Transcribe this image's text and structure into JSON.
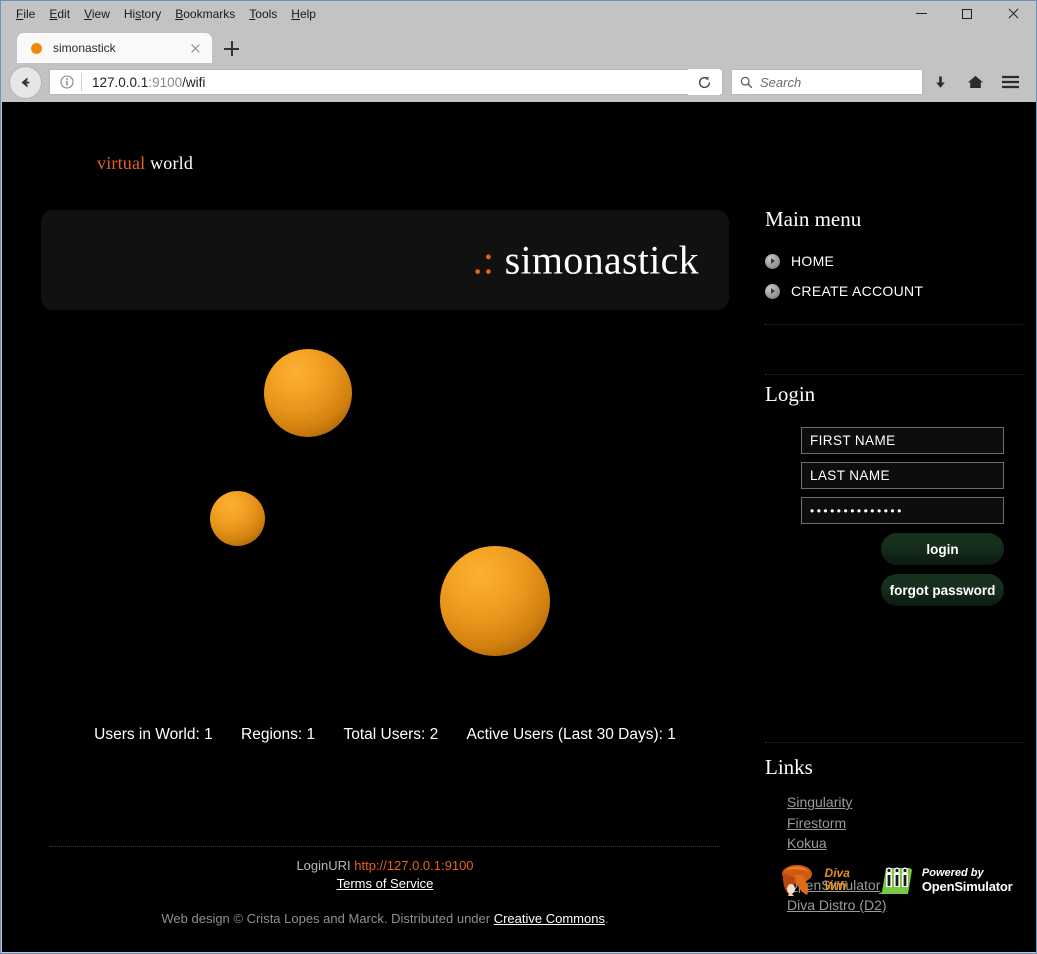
{
  "browser": {
    "menus": [
      "File",
      "Edit",
      "View",
      "History",
      "Bookmarks",
      "Tools",
      "Help"
    ],
    "tab": {
      "title": "simonastick",
      "favicon": "orange-dot-favicon"
    },
    "newtab_label": "+",
    "url": {
      "host": "127.0.0.1",
      "port": ":9100",
      "path": "/wifi",
      "full": "127.0.0.1:9100/wifi"
    },
    "search_placeholder": "Search",
    "window_controls": {
      "minimize": "–",
      "maximize": "□",
      "close": "×"
    }
  },
  "page": {
    "brand": {
      "orange": "virtual",
      "white": "world"
    },
    "banner": {
      "dots": ".:",
      "title": "simonastick"
    },
    "stats": [
      "Users in World: 1",
      "Regions: 1",
      "Total Users: 2",
      "Active Users (Last 30 Days): 1"
    ],
    "footer": {
      "loginuri_label": "LoginURI",
      "loginuri_value": "http://127.0.0.1:9100",
      "terms_label": "Terms of Service",
      "credit_prefix": "Web design © Crista Lopes and Marck. Distributed under ",
      "credit_link": "Creative Commons",
      "credit_suffix": "."
    }
  },
  "sidebar": {
    "main_menu": {
      "heading": "Main menu",
      "items": [
        {
          "label": "HOME"
        },
        {
          "label": "CREATE ACCOUNT"
        }
      ]
    },
    "login": {
      "heading": "Login",
      "first_name_value": "FIRST NAME",
      "last_name_value": "LAST NAME",
      "password_value": "••••••••••••••",
      "login_button": "login",
      "forgot_button": "forgot password"
    },
    "links": {
      "heading": "Links",
      "group_one": [
        "Singularity",
        "Firestorm",
        "Kokua"
      ],
      "group_two": [
        "OpenSimulator",
        "Diva Distro (D2)"
      ]
    },
    "logos": {
      "diva": {
        "line1": "Diva",
        "line2": "Wifi"
      },
      "opensim": {
        "line1": "Powered by",
        "line2": "OpenSimulator"
      }
    }
  },
  "colors": {
    "accent_orange": "#e8621a",
    "sphere_orange": "#f5a525",
    "page_bg": "#000000",
    "banner_bg": "#111111",
    "button_green": "#16301c",
    "link_gray": "#9a9a9a"
  }
}
